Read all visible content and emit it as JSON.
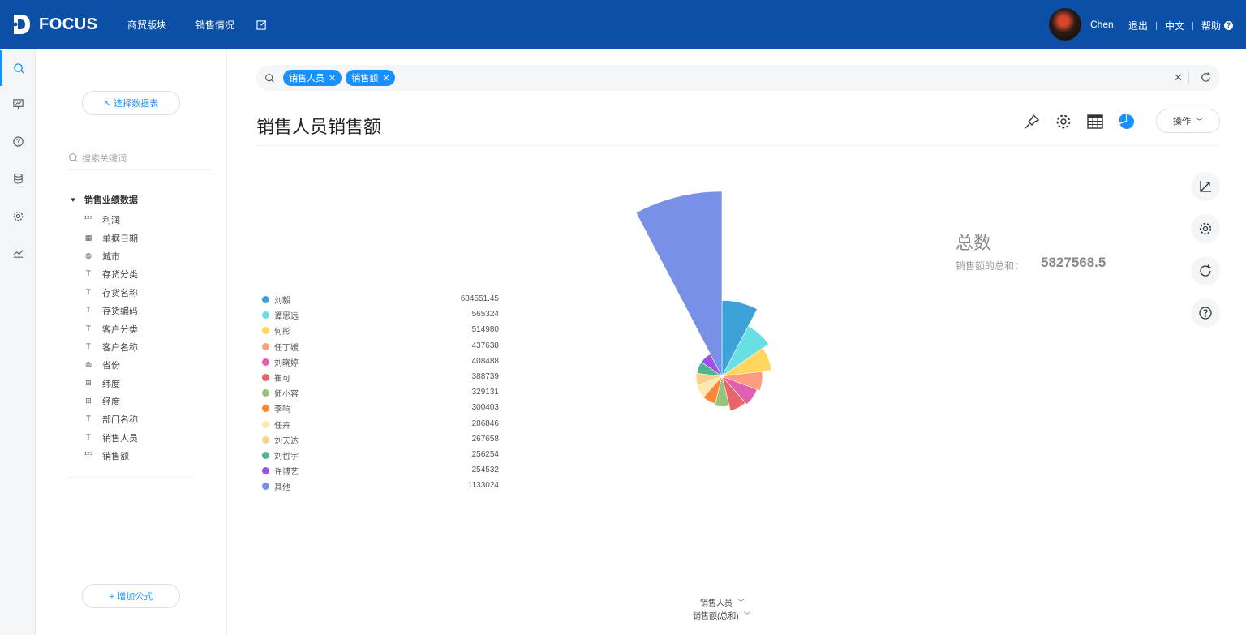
{
  "app": {
    "logo_text": "FOCUS",
    "nav": [
      "商贸版块",
      "销售情况"
    ],
    "user_name": "Chen",
    "logout": "退出",
    "language": "中文",
    "help": "帮助"
  },
  "panel": {
    "select_table": "↖ 选择数据表",
    "search_placeholder": "搜索关键词",
    "tree_root": "销售业绩数据",
    "fields": [
      {
        "icon": "number-icon",
        "label": "利润"
      },
      {
        "icon": "calendar-icon",
        "label": "单据日期"
      },
      {
        "icon": "globe-icon",
        "label": "城市"
      },
      {
        "icon": "text-icon",
        "label": "存货分类"
      },
      {
        "icon": "text-icon",
        "label": "存货名称"
      },
      {
        "icon": "text-icon",
        "label": "存货编码"
      },
      {
        "icon": "text-icon",
        "label": "客户分类"
      },
      {
        "icon": "text-icon",
        "label": "客户名称"
      },
      {
        "icon": "globe-icon",
        "label": "省份"
      },
      {
        "icon": "latlng-icon",
        "label": "纬度"
      },
      {
        "icon": "latlng-icon",
        "label": "经度"
      },
      {
        "icon": "text-icon",
        "label": "部门名称"
      },
      {
        "icon": "text-icon",
        "label": "销售人员"
      },
      {
        "icon": "number-icon",
        "label": "销售额"
      }
    ],
    "add_formula": "+ 增加公式"
  },
  "query": {
    "tokens": [
      "销售人员",
      "销售额"
    ]
  },
  "page": {
    "title": "销售人员销售额",
    "ops_label": "操作"
  },
  "summary": {
    "title": "总数",
    "label": "销售额的总和：",
    "value": "5827568.5"
  },
  "axis": {
    "dimension": "销售人员",
    "measure": "销售额(总和)"
  },
  "chart_data": {
    "type": "pie",
    "variant": "nightingale-rose",
    "categories": [
      "刘毅",
      "谭思远",
      "何彤",
      "任丁媛",
      "刘晓婷",
      "崔可",
      "师小容",
      "李响",
      "任卉",
      "刘天达",
      "刘哲宇",
      "许博艺",
      "其他"
    ],
    "values": [
      684551.45,
      565324,
      514980,
      437638,
      408488,
      388739,
      329131,
      300403,
      286846,
      267658,
      256254,
      254532,
      1133024
    ],
    "value_labels": [
      "684551.45",
      "565324",
      "514980",
      "437638",
      "408488",
      "388739",
      "329131",
      "300403",
      "286846",
      "267658",
      "256254",
      "254532",
      "1133024"
    ],
    "colors": [
      "#3ca2d8",
      "#67dfe3",
      "#ffd75e",
      "#ff9c7f",
      "#e062ae",
      "#e8666a",
      "#96c47c",
      "#fd8535",
      "#fde9ac",
      "#f8d18a",
      "#4db68c",
      "#9d52e7",
      "#7891e6"
    ],
    "legend_position": "left",
    "total": 5827568.5
  }
}
